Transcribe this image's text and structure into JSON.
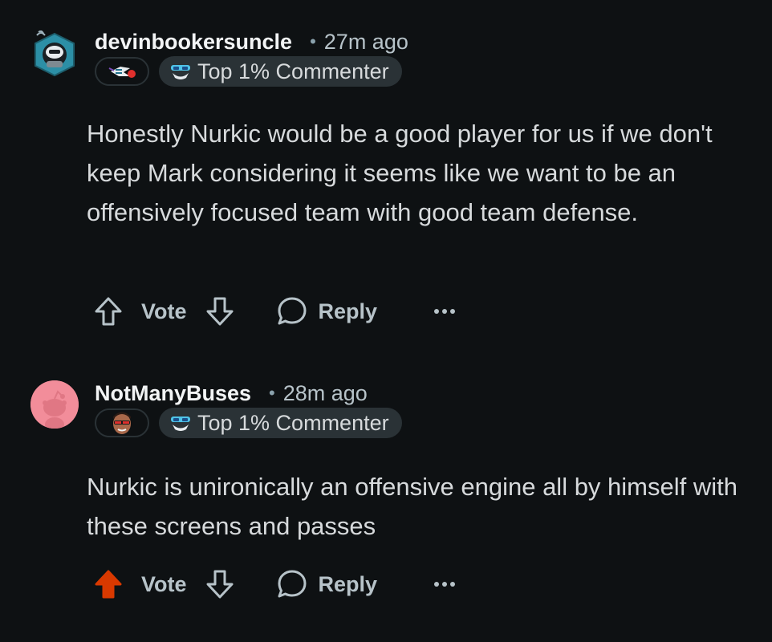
{
  "comments": [
    {
      "username": "devinbookersuncle",
      "separator": "•",
      "time": "27m ago",
      "badge_label": "Top 1% Commenter",
      "avatar_icon": "robot-avatar-icon",
      "flair_icon": "hornets-flair-icon",
      "body": "Honestly Nurkic would be a good player for us if we don't keep Mark considering it seems like we want to be an offensively focused team with good team defense.",
      "vote_label": "Vote",
      "reply_label": "Reply",
      "upvoted": false
    },
    {
      "username": "NotManyBuses",
      "separator": "•",
      "time": "28m ago",
      "badge_label": "Top 1% Commenter",
      "avatar_icon": "default-snoo-avatar-icon",
      "flair_icon": "player-face-flair-icon",
      "body": "Nurkic is unironically an offensive engine all by himself with these screens and passes",
      "vote_label": "Vote",
      "reply_label": "Reply",
      "upvoted": true
    }
  ],
  "colors": {
    "background": "#0e1113",
    "upvote_active": "#d93900",
    "badge_bg": "#2a3236",
    "muted_text": "#b7c3c9"
  }
}
